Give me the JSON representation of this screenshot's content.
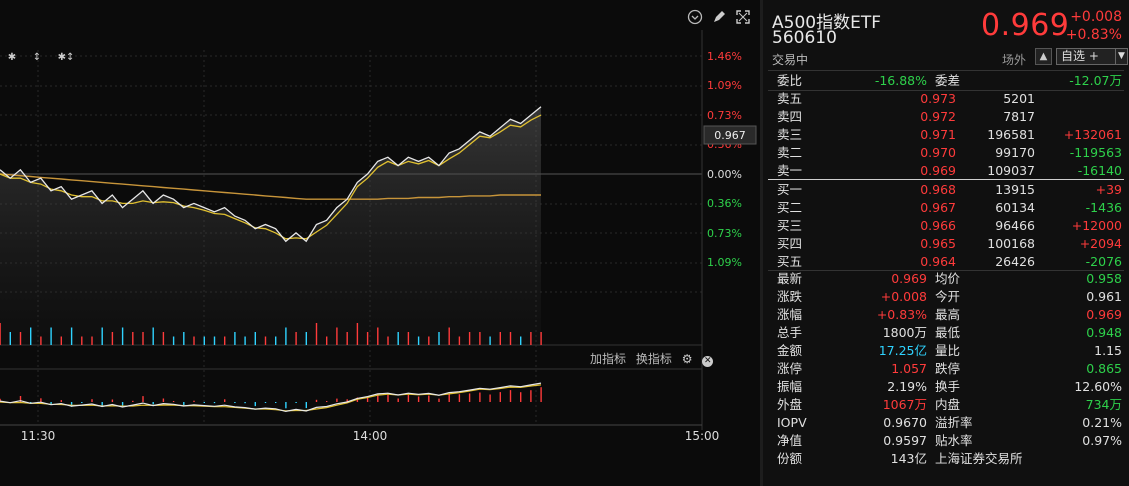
{
  "chart": {
    "pct_labels_top": [
      "1.46%",
      "1.09%",
      "0.73%",
      "0.36%",
      "0.00%"
    ],
    "pct_labels_bottom": [
      "0.36%",
      "0.73%",
      "1.09%"
    ],
    "price_tag": "0.967",
    "time_labels": [
      "11:30",
      "14:00",
      "15:00"
    ],
    "markers": [
      "✱",
      "↕",
      "✱↕"
    ],
    "indicators": {
      "add": "加指标",
      "switch": "换指标"
    },
    "colors": {
      "price_line": "#e8e8e8",
      "avg_line": "#e0c030",
      "ref_line": "#c8953a",
      "up": "#ff3b3b",
      "down": "#2fd3ff"
    },
    "chart_data": {
      "type": "line",
      "series": [
        {
          "values": [
            0.9615,
            0.9605,
            0.9615,
            0.96,
            0.9605,
            0.959,
            0.9595,
            0.958,
            0.9585,
            0.959,
            0.9575,
            0.9585,
            0.957,
            0.958,
            0.959,
            0.9575,
            0.9585,
            0.958,
            0.957,
            0.9575,
            0.957,
            0.9565,
            0.957,
            0.956,
            0.9555,
            0.9545,
            0.955,
            0.9545,
            0.953,
            0.954,
            0.953,
            0.955,
            0.9555,
            0.957,
            0.958,
            0.96,
            0.961,
            0.9625,
            0.963,
            0.962,
            0.963,
            0.9625,
            0.963,
            0.962,
            0.9635,
            0.964,
            0.965,
            0.966,
            0.9655,
            0.9665,
            0.9675,
            0.967,
            0.968,
            0.969
          ]
        },
        {
          "values": [
            0.961,
            0.9605,
            0.9605,
            0.96,
            0.9598,
            0.9592,
            0.959,
            0.9585,
            0.9583,
            0.9583,
            0.9578,
            0.9578,
            0.9575,
            0.9575,
            0.9578,
            0.9576,
            0.9577,
            0.9576,
            0.9572,
            0.957,
            0.9567,
            0.9563,
            0.9562,
            0.9557,
            0.9552,
            0.9546,
            0.9545,
            0.954,
            0.9533,
            0.9534,
            0.9533,
            0.9541,
            0.9549,
            0.9562,
            0.9575,
            0.9595,
            0.9605,
            0.9618,
            0.9625,
            0.962,
            0.9625,
            0.9622,
            0.9626,
            0.962,
            0.9628,
            0.9635,
            0.9645,
            0.9655,
            0.9653,
            0.966,
            0.9668,
            0.9666,
            0.9674,
            0.968
          ]
        },
        {
          "values": [
            0.961,
            0.9609,
            0.9608,
            0.9607,
            0.9606,
            0.9605,
            0.9604,
            0.9603,
            0.9602,
            0.9601,
            0.96,
            0.9599,
            0.9598,
            0.9597,
            0.9596,
            0.9595,
            0.9594,
            0.9593,
            0.9592,
            0.9591,
            0.959,
            0.9589,
            0.9588,
            0.9587,
            0.9586,
            0.9585,
            0.9584,
            0.9583,
            0.9582,
            0.9581,
            0.958,
            0.958,
            0.958,
            0.958,
            0.958,
            0.958,
            0.958,
            0.958,
            0.9581,
            0.9581,
            0.9581,
            0.9582,
            0.9582,
            0.9582,
            0.9583,
            0.9583,
            0.9584,
            0.9584,
            0.9584,
            0.9585,
            0.9585,
            0.9585,
            0.9585,
            0.9585
          ]
        }
      ]
    }
  },
  "quote": {
    "name": "A500指数ETF",
    "code": "560610",
    "status": "交易中",
    "price": "0.969",
    "change": "+0.008",
    "change_pct": "+0.83%",
    "venue": "场外",
    "bell": "▲",
    "watchlist": "自选 +",
    "watch_caret": "▼",
    "commission": {
      "label1": "委比",
      "val1": "-16.88%",
      "label2": "委差",
      "val2": "-12.07万"
    },
    "asks": [
      {
        "label": "卖五",
        "price": "0.973",
        "vol": "5201",
        "delta": ""
      },
      {
        "label": "卖四",
        "price": "0.972",
        "vol": "7817",
        "delta": ""
      },
      {
        "label": "卖三",
        "price": "0.971",
        "vol": "196581",
        "delta": "+132061"
      },
      {
        "label": "卖二",
        "price": "0.970",
        "vol": "99170",
        "delta": "-119563"
      },
      {
        "label": "卖一",
        "price": "0.969",
        "vol": "109037",
        "delta": "-16140"
      }
    ],
    "bids": [
      {
        "label": "买一",
        "price": "0.968",
        "vol": "13915",
        "delta": "+39"
      },
      {
        "label": "买二",
        "price": "0.967",
        "vol": "60134",
        "delta": "-1436"
      },
      {
        "label": "买三",
        "price": "0.966",
        "vol": "96466",
        "delta": "+12000"
      },
      {
        "label": "买四",
        "price": "0.965",
        "vol": "100168",
        "delta": "+2094"
      },
      {
        "label": "买五",
        "price": "0.964",
        "vol": "26426",
        "delta": "-2076"
      }
    ],
    "stats": [
      {
        "l1": "最新",
        "v1": "0.969",
        "c1": "red",
        "l2": "均价",
        "v2": "0.958",
        "c2": "green"
      },
      {
        "l1": "涨跌",
        "v1": "+0.008",
        "c1": "red",
        "l2": "今开",
        "v2": "0.961",
        "c2": "white"
      },
      {
        "l1": "涨幅",
        "v1": "+0.83%",
        "c1": "red",
        "l2": "最高",
        "v2": "0.969",
        "c2": "red"
      },
      {
        "l1": "总手",
        "v1": "1800万",
        "c1": "white",
        "l2": "最低",
        "v2": "0.948",
        "c2": "green"
      },
      {
        "l1": "金额",
        "v1": "17.25亿",
        "c1": "cyan",
        "l2": "量比",
        "v2": "1.15",
        "c2": "white"
      },
      {
        "l1": "涨停",
        "v1": "1.057",
        "c1": "red",
        "l2": "跌停",
        "v2": "0.865",
        "c2": "green"
      },
      {
        "l1": "振幅",
        "v1": "2.19%",
        "c1": "white",
        "l2": "换手",
        "v2": "12.60%",
        "c2": "white"
      },
      {
        "l1": "外盘",
        "v1": "1067万",
        "c1": "red",
        "l2": "内盘",
        "v2": "734万",
        "c2": "green"
      },
      {
        "l1": "IOPV",
        "v1": "0.9670",
        "c1": "white",
        "l2": "溢折率",
        "v2": "0.21%",
        "c2": "white"
      },
      {
        "l1": "净值",
        "v1": "0.9597",
        "c1": "white",
        "l2": "贴水率",
        "v2": "0.97%",
        "c2": "white"
      },
      {
        "l1": "份额",
        "v1": "143亿",
        "c1": "white",
        "l2": "上海证券交易所",
        "v2": "",
        "c2": "white"
      }
    ]
  }
}
